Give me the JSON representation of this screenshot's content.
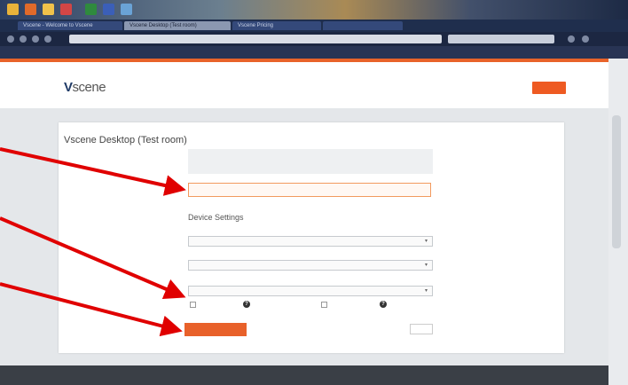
{
  "taskbar": {
    "icons": [
      "file-explorer-icon",
      "firefox-icon",
      "folder-icon",
      "media-icon",
      "excel-icon",
      "word-icon",
      "image-icon"
    ],
    "clock": ""
  },
  "browser": {
    "tabs": [
      {
        "label": "Vscene - Welcome to Vscene"
      },
      {
        "label": "Vscene Desktop (Test room)"
      },
      {
        "label": "Vscene Pricing"
      },
      {
        "label": ""
      }
    ],
    "url": "",
    "search_placeholder": "",
    "bookmarks": [
      "",
      "",
      "",
      "",
      ""
    ]
  },
  "site": {
    "logo_v": "V",
    "logo_text": "scene",
    "download_link": "",
    "top_button": ""
  },
  "form": {
    "title": "Vscene Desktop (Test room)",
    "notice": "",
    "name_label": "",
    "name_value": "",
    "device_settings_title": "Device Settings",
    "camera_label": "",
    "camera_value": "",
    "microphone_label": "",
    "microphone_value": "",
    "speaker_label": "",
    "speaker_value": "",
    "checkbox1_label": "",
    "checkbox2_label": "",
    "help_glyph": "?",
    "join_button": "",
    "cancel_button": ""
  },
  "footer": {
    "col1": "",
    "col2": "",
    "col3": ""
  },
  "colors": {
    "accent": "#e8612a",
    "arrow": "#e00000"
  }
}
